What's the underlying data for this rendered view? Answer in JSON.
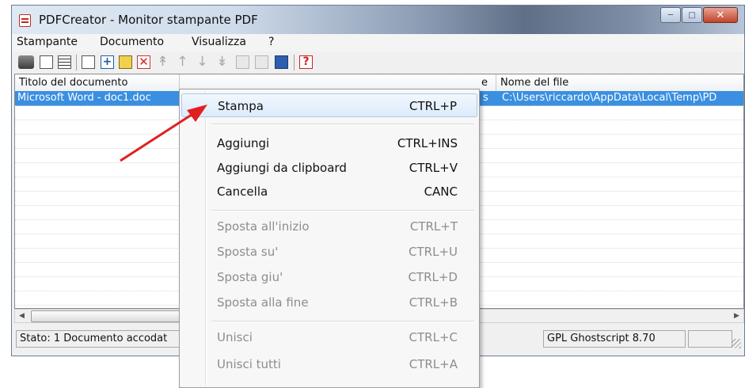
{
  "window": {
    "title": "PDFCreator - Monitor stampante PDF",
    "icon": "pdfcreator-icon",
    "controls": {
      "minimize": "minimize-icon",
      "maximize": "maximize-icon",
      "close": "close-icon"
    }
  },
  "menubar": {
    "items": [
      {
        "label": "Stampante"
      },
      {
        "label": "Documento"
      },
      {
        "label": "Visualizza"
      },
      {
        "label": "?"
      }
    ]
  },
  "toolbar": {
    "buttons": [
      "printer-icon",
      "document-properties-icon",
      "document-list-icon",
      "new-document-icon",
      "add-document-icon",
      "clipboard-add-icon",
      "delete-document-icon",
      "move-top-icon",
      "move-up-icon",
      "move-down-icon",
      "move-bottom-icon",
      "combine-icon",
      "combine-all-icon",
      "save-icon",
      "help-icon"
    ]
  },
  "listview": {
    "columns": [
      {
        "label": "Titolo del documento"
      },
      {
        "label": "e"
      },
      {
        "label": "Nome del file"
      }
    ],
    "rows": [
      {
        "title": "Microsoft Word - doc1.doc",
        "mid": "s",
        "filename": "C:\\Users\\riccardo\\AppData\\Local\\Temp\\PD"
      }
    ]
  },
  "statusbar": {
    "status": "Stato: 1 Documento accodat",
    "engine": "GPL Ghostscript 8.70"
  },
  "context_menu": {
    "items": [
      {
        "label": "Stampa",
        "shortcut": "CTRL+P",
        "enabled": true,
        "highlighted": true
      },
      {
        "label": "Aggiungi",
        "shortcut": "CTRL+INS",
        "enabled": true
      },
      {
        "label": "Aggiungi da clipboard",
        "shortcut": "CTRL+V",
        "enabled": true
      },
      {
        "label": "Cancella",
        "shortcut": "CANC",
        "enabled": true
      },
      {
        "label": "Sposta all'inizio",
        "shortcut": "CTRL+T",
        "enabled": false
      },
      {
        "label": "Sposta su'",
        "shortcut": "CTRL+U",
        "enabled": false
      },
      {
        "label": "Sposta giu'",
        "shortcut": "CTRL+D",
        "enabled": false
      },
      {
        "label": "Sposta alla fine",
        "shortcut": "CTRL+B",
        "enabled": false
      },
      {
        "label": "Unisci",
        "shortcut": "CTRL+C",
        "enabled": false
      },
      {
        "label": "Unisci tutti",
        "shortcut": "CTRL+A",
        "enabled": false
      }
    ]
  },
  "annotation": {
    "arrow_color": "#e02020"
  },
  "colors": {
    "selection": "#3a8fe0",
    "menu_highlight": "#dcebfb"
  }
}
